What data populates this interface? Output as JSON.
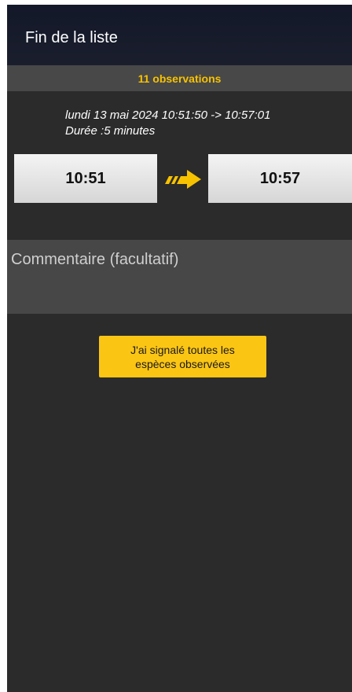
{
  "header": {
    "title": "Fin de la liste"
  },
  "summary": {
    "observations_label": "11 observations"
  },
  "session": {
    "date_range": "lundi 13 mai 2024 10:51:50 -> 10:57:01",
    "duration": "Durée :5 minutes",
    "start_time": "10:51",
    "end_time": "10:57",
    "arrow_icon": "arrow-right-icon"
  },
  "comment": {
    "placeholder": "Commentaire (facultatif)",
    "value": ""
  },
  "actions": {
    "done_line1": "J'ai signalé toutes les",
    "done_line2": "espèces observées"
  },
  "colors": {
    "accent": "#f7c200",
    "button_yellow": "#fbc514",
    "app_bar": "#13182a",
    "background": "#2b2b2b"
  }
}
